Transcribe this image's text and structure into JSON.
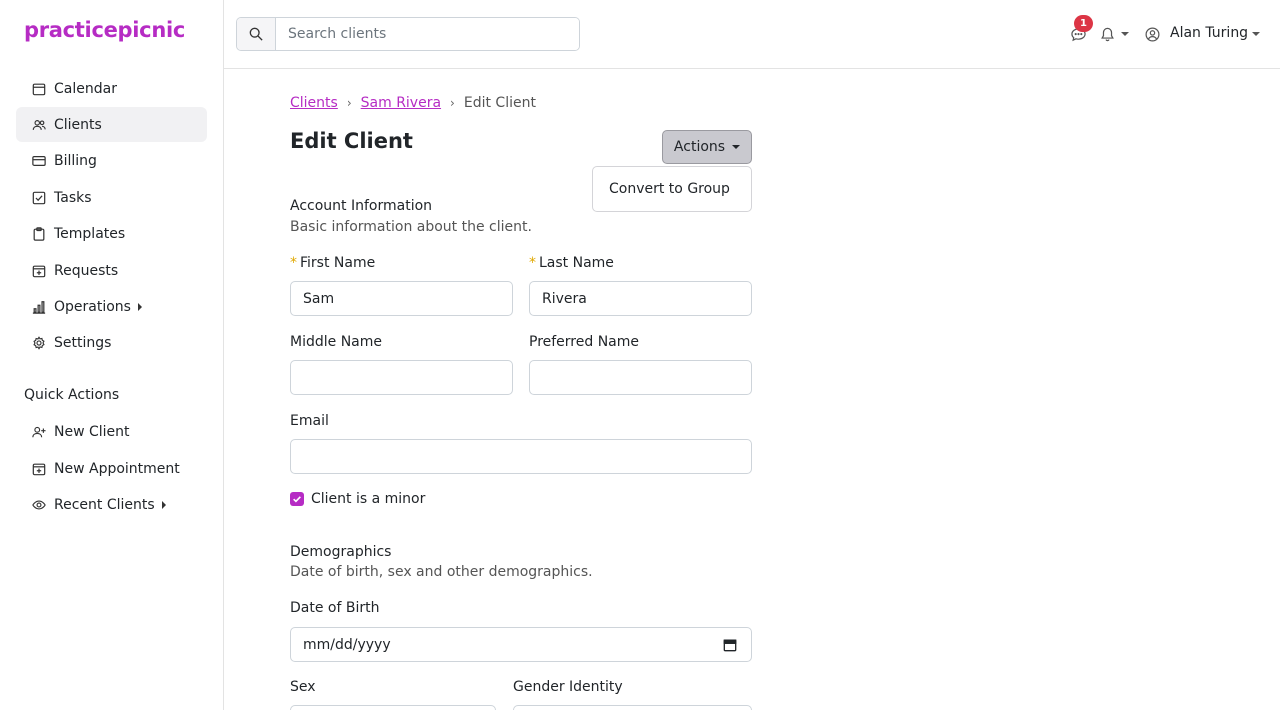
{
  "brand": "practicepicnic",
  "sidebar": {
    "items": [
      {
        "label": "Calendar"
      },
      {
        "label": "Clients"
      },
      {
        "label": "Billing"
      },
      {
        "label": "Tasks"
      },
      {
        "label": "Templates"
      },
      {
        "label": "Requests"
      },
      {
        "label": "Operations"
      },
      {
        "label": "Settings"
      }
    ],
    "quick_actions_title": "Quick Actions",
    "quick_actions": [
      {
        "label": "New Client"
      },
      {
        "label": "New Appointment"
      },
      {
        "label": "Recent Clients"
      }
    ]
  },
  "header": {
    "search_placeholder": "Search clients",
    "messages_badge": "1",
    "user_name": "Alan Turing"
  },
  "breadcrumb": {
    "items": [
      "Clients",
      "Sam Rivera"
    ],
    "current": "Edit Client"
  },
  "page": {
    "title": "Edit Client",
    "actions_label": "Actions",
    "dropdown_items": [
      "Convert to Group"
    ]
  },
  "account": {
    "heading": "Account Information",
    "subheading": "Basic information about the client.",
    "first_name_label": "First Name",
    "first_name_value": "Sam",
    "last_name_label": "Last Name",
    "last_name_value": "Rivera",
    "middle_name_label": "Middle Name",
    "middle_name_value": "",
    "preferred_name_label": "Preferred Name",
    "preferred_name_value": "",
    "email_label": "Email",
    "email_value": "",
    "minor_label": "Client is a minor",
    "minor_checked": true
  },
  "demographics": {
    "heading": "Demographics",
    "subheading": "Date of birth, sex and other demographics.",
    "dob_label": "Date of Birth",
    "dob_placeholder": "mm/dd/yyyy",
    "sex_label": "Sex",
    "gender_label": "Gender Identity"
  },
  "colors": {
    "accent": "#b62cc4",
    "required": "#e0a800",
    "badge": "#dc3545"
  }
}
